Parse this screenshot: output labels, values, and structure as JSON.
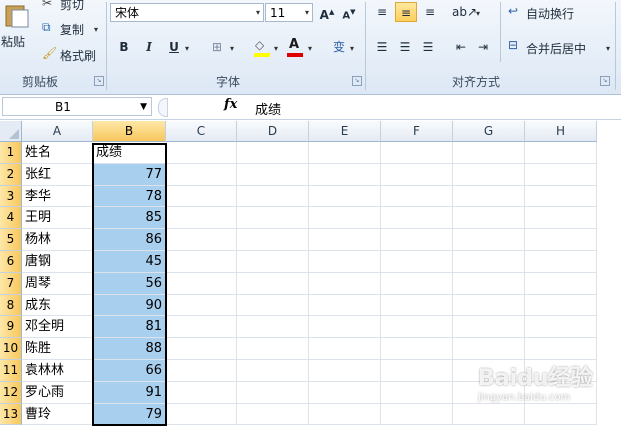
{
  "clipboard": {
    "paste_label": "粘贴",
    "cut_label": "剪切",
    "copy_label": "复制",
    "format_painter_label": "格式刷",
    "group_label": "剪贴板"
  },
  "font": {
    "font_name": "宋体",
    "font_size": "11",
    "bold": "B",
    "italic": "I",
    "underline": "U",
    "phonetic": "变",
    "group_label": "字体"
  },
  "alignment": {
    "wrap_text_label": "自动换行",
    "merge_center_label": "合并后居中",
    "group_label": "对齐方式"
  },
  "formula_bar": {
    "name_box": "B1",
    "fx": "fx",
    "content": "成绩"
  },
  "columns": [
    "A",
    "B",
    "C",
    "D",
    "E",
    "F",
    "G",
    "H"
  ],
  "rows": [
    {
      "num": "1",
      "a": "姓名",
      "b": "成绩"
    },
    {
      "num": "2",
      "a": "张红",
      "b": "77"
    },
    {
      "num": "3",
      "a": "李华",
      "b": "78"
    },
    {
      "num": "4",
      "a": "王明",
      "b": "85"
    },
    {
      "num": "5",
      "a": "杨林",
      "b": "86"
    },
    {
      "num": "6",
      "a": "唐钢",
      "b": "45"
    },
    {
      "num": "7",
      "a": "周琴",
      "b": "56"
    },
    {
      "num": "8",
      "a": "成东",
      "b": "90"
    },
    {
      "num": "9",
      "a": "邓全明",
      "b": "81"
    },
    {
      "num": "10",
      "a": "陈胜",
      "b": "88"
    },
    {
      "num": "11",
      "a": "袁林林",
      "b": "66"
    },
    {
      "num": "12",
      "a": "罗心雨",
      "b": "91"
    },
    {
      "num": "13",
      "a": "曹玲",
      "b": "79"
    }
  ],
  "watermark": {
    "brand": "Baidu经验",
    "url": "jingyan.baidu.com"
  },
  "colors": {
    "selection_fill": "#a9cfef",
    "header_selected": "#f8c75c",
    "ribbon_bg": "#dde8f5"
  }
}
